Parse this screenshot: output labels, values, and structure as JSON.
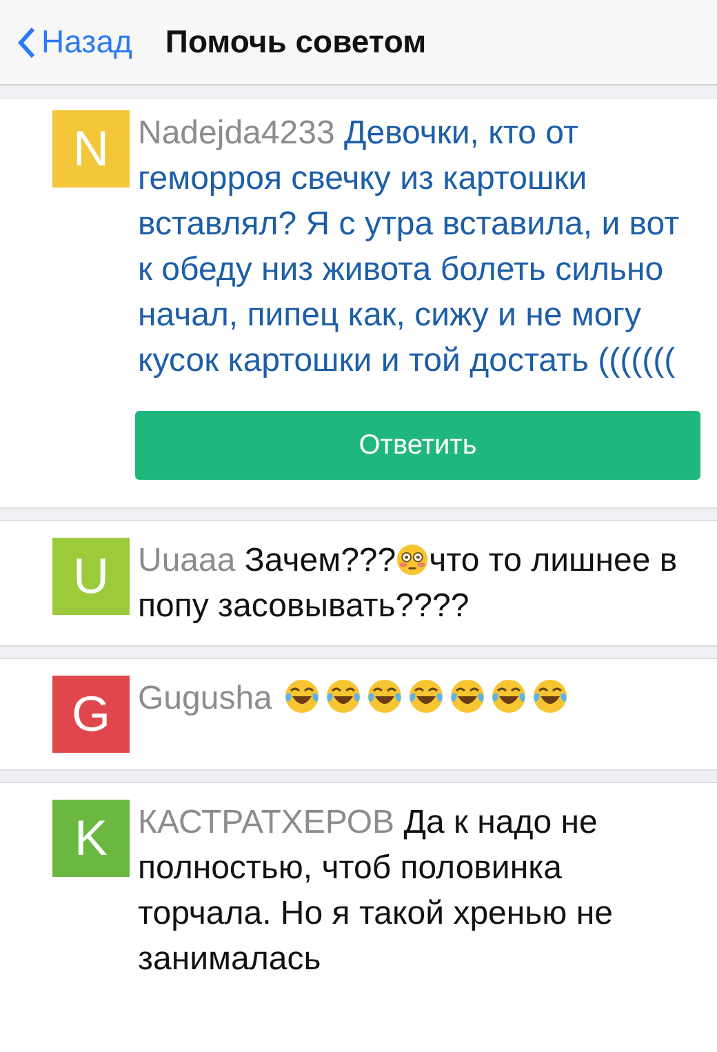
{
  "header": {
    "back": "Назад",
    "title": "Помочь советом"
  },
  "post": {
    "initial": "N",
    "color": "#f4c73a",
    "author": "Nadejda4233",
    "text": "Девочки, кто от геморроя свечку из картошки вставлял?  Я с утра вставила,  и вот к обеду низ живота болеть сильно начал, пипец как, сижу и не могу кусок картошки и той достать (((((((",
    "reply": "Ответить"
  },
  "comments": [
    {
      "initial": "U",
      "color": "#9bcb3b",
      "author": "Uuaaa",
      "parts": [
        {
          "kind": "text",
          "text": "Зачем???"
        },
        {
          "kind": "flushed"
        },
        {
          "kind": "text",
          "text": "что то лишнее в попу засовывать????"
        }
      ]
    },
    {
      "initial": "G",
      "color": "#e0474c",
      "author": "Gugusha",
      "parts": [
        {
          "kind": "laughing"
        },
        {
          "kind": "laughing"
        },
        {
          "kind": "laughing"
        },
        {
          "kind": "laughing"
        },
        {
          "kind": "laughing"
        },
        {
          "kind": "laughing"
        },
        {
          "kind": "laughing"
        }
      ]
    },
    {
      "initial": "K",
      "color": "#6ab83f",
      "author": "КАСТРАТХЕРОВ",
      "parts": [
        {
          "kind": "text",
          "text": "Да к надо не полностью, чтоб половинка торчала. Но я такой хренью не занималась"
        }
      ]
    }
  ]
}
